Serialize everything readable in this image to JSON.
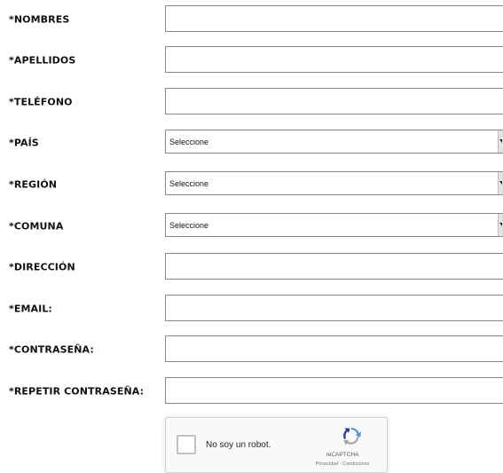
{
  "form": {
    "fields": [
      {
        "label": "*NOMBRES",
        "value": ""
      },
      {
        "label": "*APELLIDOS",
        "value": ""
      },
      {
        "label": "*TELÉFONO",
        "value": ""
      },
      {
        "label": "*PAÍS",
        "selected": "Seleccione"
      },
      {
        "label": "*REGIÓN",
        "selected": "Seleccione"
      },
      {
        "label": "*COMUNA",
        "selected": "Seleccione"
      },
      {
        "label": "*DIRECCIÓN",
        "value": ""
      },
      {
        "label": "*EMAIL:",
        "value": ""
      },
      {
        "label": "*CONTRASEÑA:",
        "value": ""
      },
      {
        "label": "*REPETIR CONTRASEÑA:",
        "value": ""
      }
    ]
  },
  "captcha": {
    "label": "No soy un robot.",
    "brand": "reCAPTCHA",
    "terms": "Privacidad - Condiciones",
    "icon": "recaptcha-logo-icon",
    "checked": false
  },
  "colors": {
    "border": "#8a8a8a",
    "label_text": "#111111",
    "captcha_bg": "#f9f9f9"
  }
}
